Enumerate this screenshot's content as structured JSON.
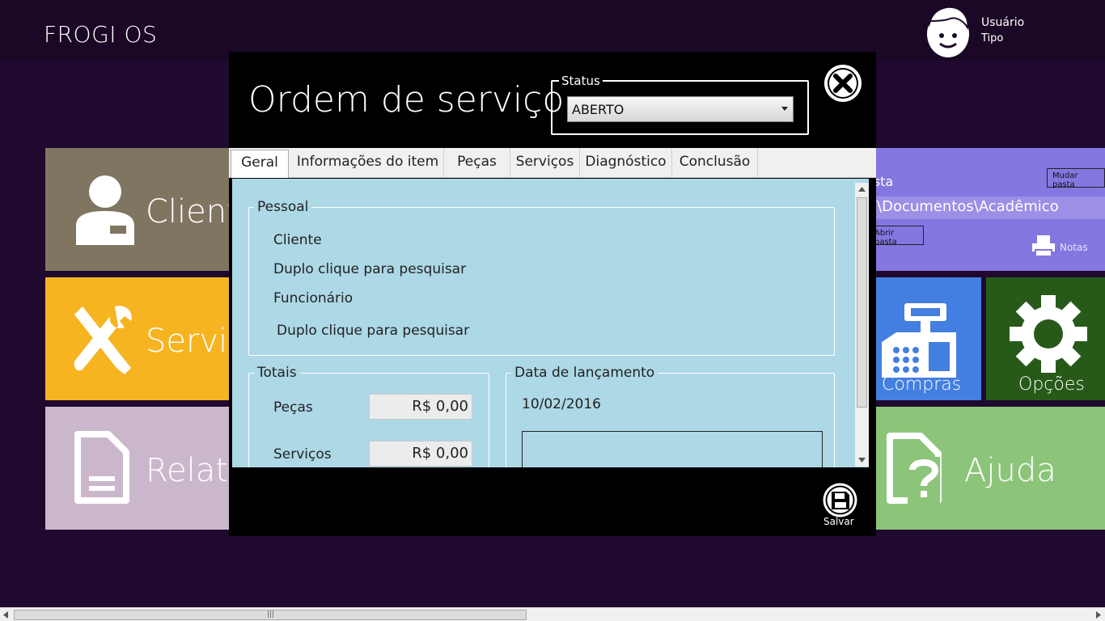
{
  "app": {
    "title": "FROGI OS"
  },
  "user": {
    "name": "Usuário",
    "type": "Tipo",
    "avatar_icon": "user-face-icon"
  },
  "tiles": {
    "clientes": {
      "label": "Cliente",
      "icon": "user-icon",
      "color": "#807561"
    },
    "servicos": {
      "label": "Serviço",
      "icon": "tools-icon",
      "color": "#f6b421"
    },
    "relatorios": {
      "label": "Relató",
      "icon": "document-icon",
      "color": "#cbb7cc"
    },
    "pasta": {
      "title": "asta",
      "change_button": "Mudar pasta",
      "path": ":\\Documentos\\Acadêmico",
      "open_button": "Abrir pasta",
      "notes_label": "Notas",
      "color": "#8477e0"
    },
    "compras": {
      "label": "Compras",
      "icon": "cash-register-icon",
      "color": "#437fe0"
    },
    "opcoes": {
      "label": "Opções",
      "icon": "gear-icon",
      "color": "#275a19"
    },
    "ajuda": {
      "label": "Ajuda",
      "icon": "help-document-icon",
      "color": "#8cc57a"
    }
  },
  "modal": {
    "title": "Ordem de serviço",
    "status": {
      "legend": "Status",
      "value": "ABERTO"
    },
    "tabs": [
      {
        "label": "Geral",
        "active": true
      },
      {
        "label": "Informações do item"
      },
      {
        "label": "Peças"
      },
      {
        "label": "Serviços"
      },
      {
        "label": "Diagnóstico"
      },
      {
        "label": "Conclusão"
      }
    ],
    "pessoal": {
      "legend": "Pessoal",
      "cliente_label": "Cliente",
      "cliente_value": "Duplo clique para pesquisar",
      "funcionario_label": "Funcionário",
      "funcionario_value": "Duplo clique para pesquisar"
    },
    "totais": {
      "legend": "Totais",
      "pecas_label": "Peças",
      "pecas_value": "R$ 0,00",
      "servicos_label": "Serviços",
      "servicos_value": "R$ 0,00"
    },
    "lancamento": {
      "legend": "Data de lançamento",
      "date": "10/02/2016"
    },
    "save_label": "Salvar"
  }
}
